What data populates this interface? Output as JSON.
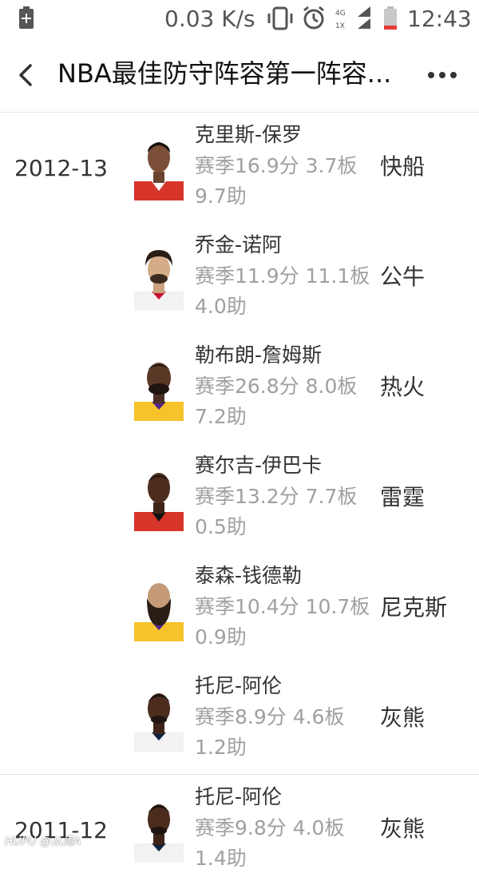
{
  "status_bar": {
    "speed": "0.03 K/s",
    "network": [
      "4G",
      "1X"
    ],
    "time": "12:43"
  },
  "header": {
    "title": "NBA最佳防守阵容第一阵容..."
  },
  "rows": [
    {
      "year": "2012-13",
      "name": "克里斯-保罗",
      "stats": "赛季16.9分  3.7板  9.7助",
      "team": "快船",
      "jersey": "#d8352a"
    },
    {
      "year": "",
      "name": "乔金-诺阿",
      "stats": "赛季11.9分  11.1板  4.0助",
      "team": "公牛",
      "jersey": "#f2f2f2"
    },
    {
      "year": "",
      "name": "勒布朗-詹姆斯",
      "stats": "赛季26.8分  8.0板  7.2助",
      "team": "热火",
      "jersey": "#f6c32b"
    },
    {
      "year": "",
      "name": "赛尔吉-伊巴卡",
      "stats": "赛季13.2分  7.7板  0.5助",
      "team": "雷霆",
      "jersey": "#d8352a"
    },
    {
      "year": "",
      "name": "泰森-钱德勒",
      "stats": "赛季10.4分  10.7板  0.9助",
      "team": "尼克斯",
      "jersey": "#f6c32b"
    },
    {
      "year": "",
      "name": "托尼-阿伦",
      "stats": "赛季8.9分  4.6板  1.2助",
      "team": "灰熊",
      "jersey": "#f2f2f2"
    },
    {
      "year": "2011-12",
      "name": "托尼-阿伦",
      "stats": "赛季9.8分  4.0板  1.4助",
      "team": "灰熊",
      "jersey": "#f2f2f2"
    }
  ],
  "watermark": "HUPU @从周A"
}
